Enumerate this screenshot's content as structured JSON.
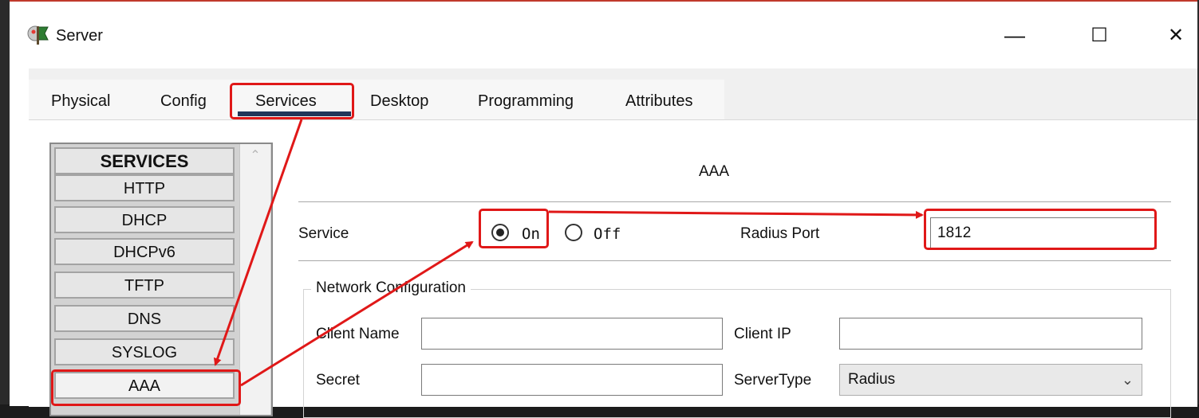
{
  "window": {
    "title": "Server",
    "icon": "server-app-icon",
    "controls": {
      "minimize": "—",
      "maximize": "☐",
      "close": "✕"
    }
  },
  "tabs": [
    {
      "label": "Physical",
      "active": false
    },
    {
      "label": "Config",
      "active": false
    },
    {
      "label": "Services",
      "active": true
    },
    {
      "label": "Desktop",
      "active": false
    },
    {
      "label": "Programming",
      "active": false
    },
    {
      "label": "Attributes",
      "active": false
    }
  ],
  "services": {
    "header": "SERVICES",
    "items": [
      "HTTP",
      "DHCP",
      "DHCPv6",
      "TFTP",
      "DNS",
      "SYSLOG",
      "AAA"
    ],
    "selected": "AAA"
  },
  "aaa": {
    "section_title": "AAA",
    "service_label": "Service",
    "radio_on": "On",
    "radio_off": "Off",
    "service_state": "On",
    "radius_port_label": "Radius Port",
    "radius_port_value": "1812",
    "network_config_title": "Network Configuration",
    "client_name_label": "Client Name",
    "client_name_value": "",
    "client_ip_label": "Client IP",
    "client_ip_value": "",
    "secret_label": "Secret",
    "secret_value": "",
    "server_type_label": "ServerType",
    "server_type_value": "Radius"
  },
  "colors": {
    "highlight": "#e01818",
    "active_tab_underline": "#21365a"
  }
}
